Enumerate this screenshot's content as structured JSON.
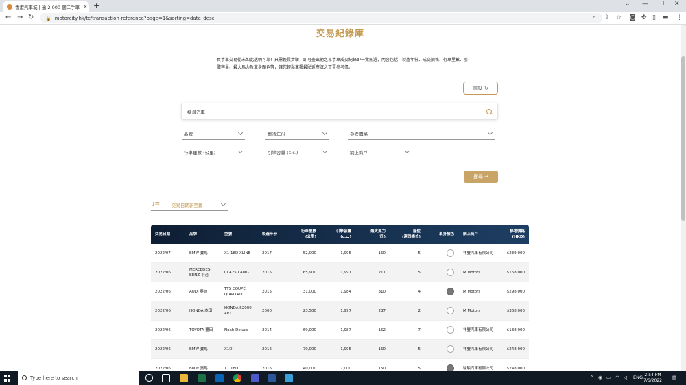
{
  "browser": {
    "tab_title": "香港汽車城 | 逾 2,000 個二手車位",
    "url": "motorcity.hk/tc/transaction-reference?page=1&sorting=date_desc"
  },
  "page": {
    "title": "交易紀錄庫",
    "description": "買手車交易從未如此透明可靠！只需輕鬆步驟，即可查出他之易手車成交紀錄即一覽無遺，內容包括：製造年份、成交價格、行車里數、引擎容量、最大馬力及車身顏色等，讓您輕鬆掌握最貼近市況之買賣參考價。",
    "reset_label": "重設",
    "search_placeholder": "搜尋汽車",
    "filters": {
      "brand": "品牌",
      "year": "製造年份",
      "price": "參考價格",
      "mileage": "行車里數 (公里)",
      "engine": "引擎容量 (c.c.)",
      "dealer": "網上商戶"
    },
    "submit_label": "搜尋 →",
    "sort_label": "交易日期新至舊"
  },
  "table": {
    "headers": {
      "date": "交易日期",
      "brand": "品牌",
      "model": "型號",
      "year": "製造年份",
      "mileage_1": "行車里數",
      "mileage_2": "(公里)",
      "engine_1": "引擎容量",
      "engine_2": "(c.c.)",
      "hp_1": "最大馬力",
      "hp_2": "(匹)",
      "seats_1": "座位",
      "seats_2": "(連司機位)",
      "color": "車身顏色",
      "dealer": "網上商戶",
      "price_1": "參考價格",
      "price_2": "(HKD)"
    },
    "rows": [
      {
        "date": "2022/07",
        "brand": "BMW 寶馬",
        "model": "X1 18D XLINE",
        "year": "2017",
        "mileage": "52,000",
        "engine": "1,995",
        "hp": "150",
        "seats": "5",
        "color": "white",
        "dealer": "祥豐汽車有限公司",
        "price": "$239,000"
      },
      {
        "date": "2022/06",
        "brand": "MERCEDES-BENZ 平治",
        "model": "CLA250 AMG",
        "year": "2015",
        "mileage": "65,900",
        "engine": "1,991",
        "hp": "211",
        "seats": "5",
        "color": "white",
        "dealer": "M Motors",
        "price": "$168,000"
      },
      {
        "date": "2022/06",
        "brand": "AUDI 奧迪",
        "model": "TTS COUPE QUATTRO",
        "year": "2015",
        "mileage": "31,000",
        "engine": "1,984",
        "hp": "310",
        "seats": "4",
        "color": "grey",
        "dealer": "M Motors",
        "price": "$298,000"
      },
      {
        "date": "2022/06",
        "brand": "HONDA 本田",
        "model": "HONDA S2000 AP1",
        "year": "2000",
        "mileage": "23,500",
        "engine": "1,997",
        "hp": "237",
        "seats": "2",
        "color": "white",
        "dealer": "M Motors",
        "price": "$368,000"
      },
      {
        "date": "2022/06",
        "brand": "TOYOTA 豐田",
        "model": "Noah Deluxe",
        "year": "2014",
        "mileage": "69,000",
        "engine": "1,987",
        "hp": "152",
        "seats": "7",
        "color": "white",
        "dealer": "祥豐汽車有限公司",
        "price": "$138,000"
      },
      {
        "date": "2022/06",
        "brand": "BMW 寶馬",
        "model": "X1D",
        "year": "2016",
        "mileage": "79,000",
        "engine": "1,995",
        "hp": "150",
        "seats": "5",
        "color": "white",
        "dealer": "祥豐汽車有限公司",
        "price": "$248,000"
      },
      {
        "date": "2022/06",
        "brand": "BMW 寶馬",
        "model": "X1 18D",
        "year": "2016",
        "mileage": "40,000",
        "engine": "2,000",
        "hp": "150",
        "seats": "5",
        "color": "grey",
        "dealer": "駿駿汽車有限公司",
        "price": "$248,000"
      }
    ]
  },
  "taskbar": {
    "search_placeholder": "Type here to search",
    "lang": "ENG",
    "time": "2:54 PM",
    "date": "7/6/2022"
  }
}
